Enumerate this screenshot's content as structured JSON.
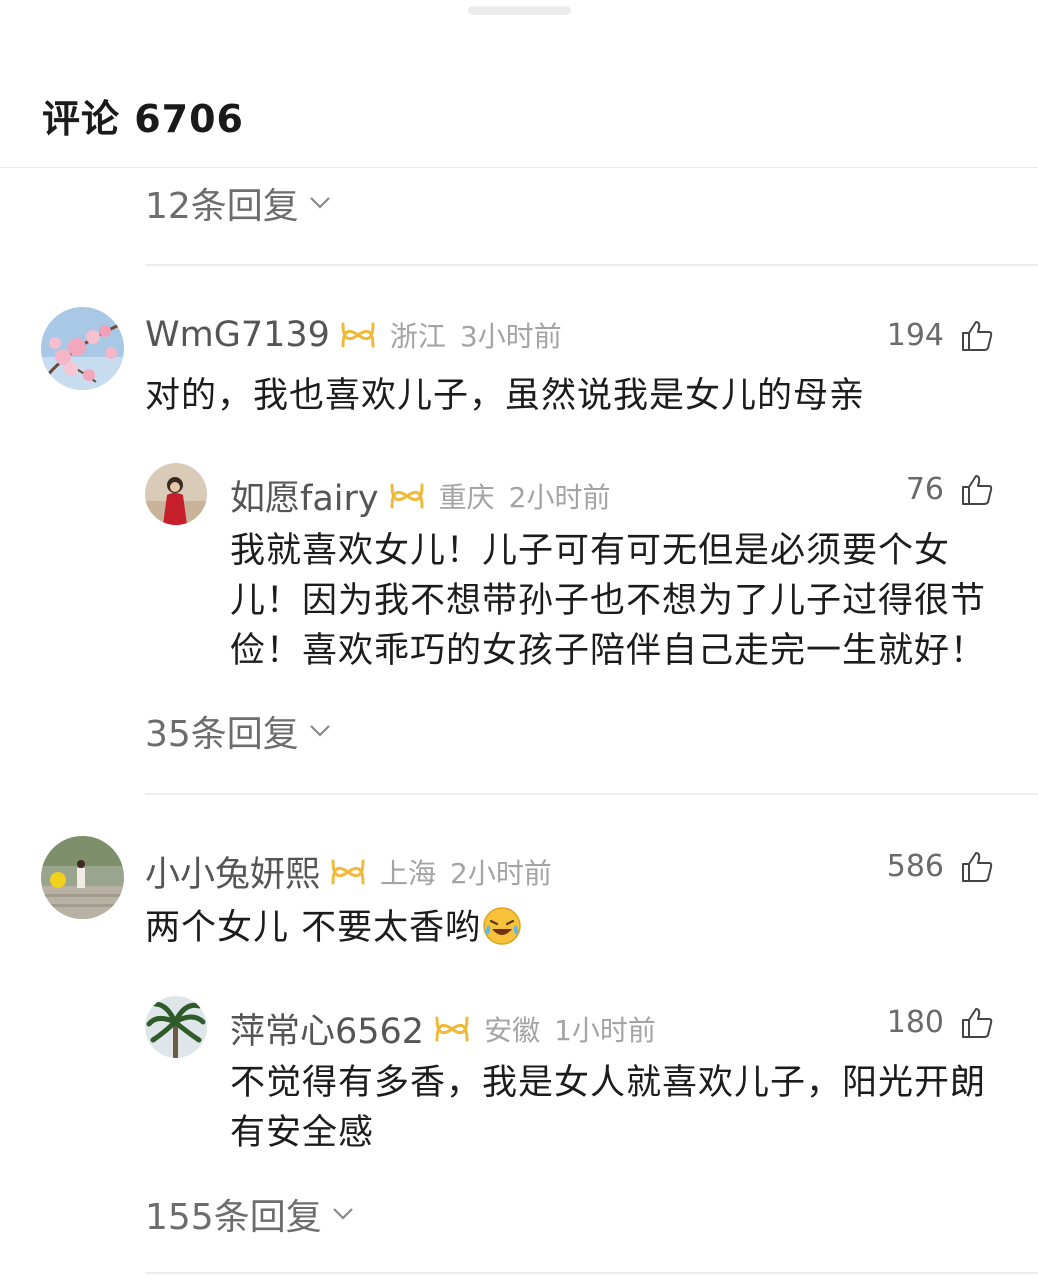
{
  "header": {
    "title": "评论 6706"
  },
  "top_reply_toggle": "12条回复",
  "threads": [
    {
      "comment": {
        "username": "WmG7139",
        "region": "浙江",
        "time": "3小时前",
        "likes": "194",
        "text": "对的，我也喜欢儿子，虽然说我是女儿的母亲"
      },
      "reply": {
        "username": "如愿fairy",
        "region": "重庆",
        "time": "2小时前",
        "likes": "76",
        "lines": [
          "我就喜欢女儿！儿子可有可无但是必须要个女",
          "儿！因为我不想带孙子也不想为了儿子过得很节",
          "俭！喜欢乖巧的女孩子陪伴自己走完一生就好！"
        ]
      },
      "reply_toggle": "35条回复"
    },
    {
      "comment": {
        "username": "小小兔妍熙",
        "region": "上海",
        "time": "2小时前",
        "likes": "586",
        "text": "两个女儿 不要太香哟",
        "emoji": "laughing-crying-emoji"
      },
      "reply": {
        "username": "萍常心6562",
        "region": "安徽",
        "time": "1小时前",
        "likes": "180",
        "lines": [
          "不觉得有多香，我是女人就喜欢儿子，阳光开朗",
          "有安全感"
        ]
      },
      "reply_toggle": "155条回复"
    }
  ],
  "colors": {
    "badge": "#f0b93a",
    "meta": "#a4a4a4",
    "text": "#1c1c1c",
    "divider": "#ededed"
  }
}
